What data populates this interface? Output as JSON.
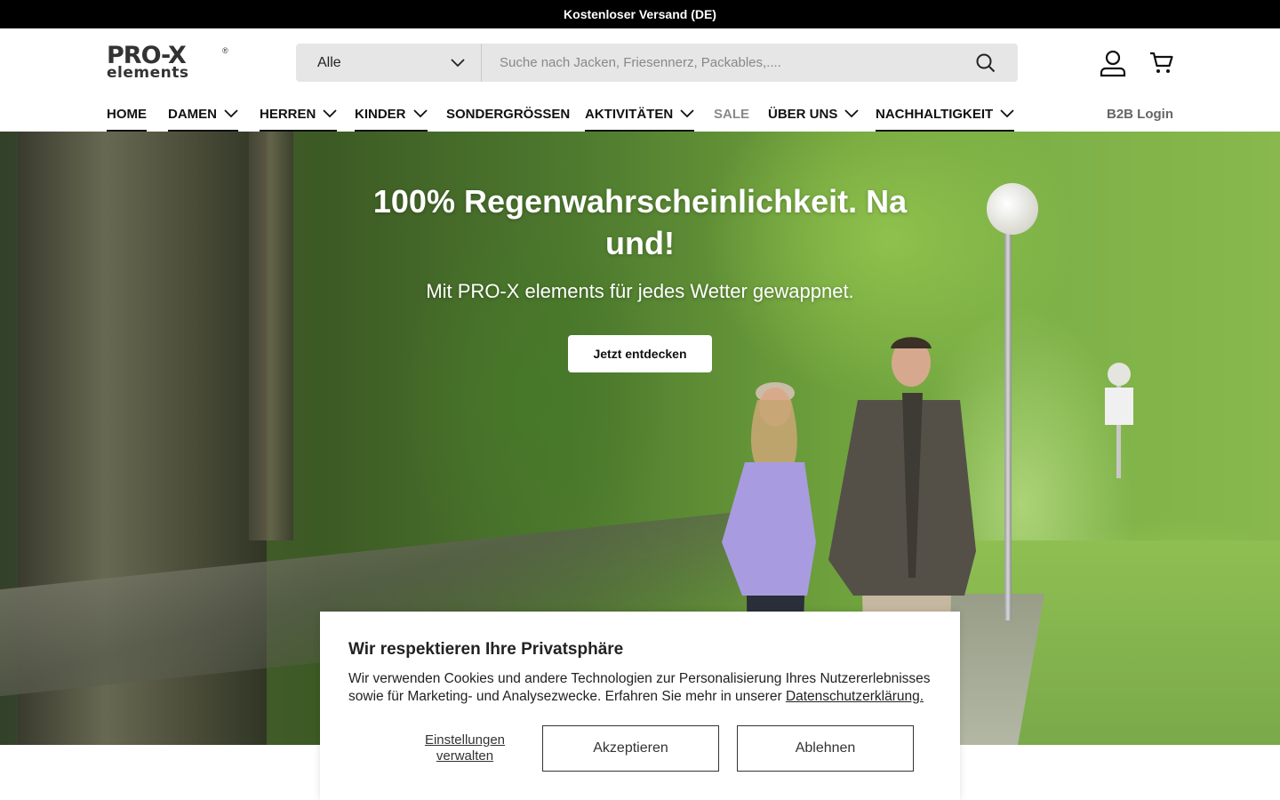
{
  "announcement": {
    "text": "Kostenloser Versand (DE)"
  },
  "logo": {
    "line1": "PRO-X",
    "line2": "elements",
    "reg": "®"
  },
  "search": {
    "category": "Alle",
    "placeholder": "Suche nach Jacken, Friesennerz, Packables,...."
  },
  "header_icons": [
    "search-icon",
    "account-icon",
    "cart-icon"
  ],
  "nav": {
    "items": [
      {
        "label": "HOME"
      },
      {
        "label": "DAMEN"
      },
      {
        "label": "HERREN"
      },
      {
        "label": "KINDER"
      },
      {
        "label": "SONDERGRÖSSEN"
      },
      {
        "label": "AKTIVITÄTEN"
      },
      {
        "label": "SALE"
      },
      {
        "label": "ÜBER UNS"
      },
      {
        "label": "NACHHALTIGKEIT"
      }
    ],
    "b2b": "B2B Login"
  },
  "hero": {
    "title": "100% Regenwahrscheinlichkeit. Na und!",
    "subtitle": "Mit PRO-X elements für jedes Wetter gewappnet.",
    "cta": "Jetzt entdecken"
  },
  "cookie": {
    "title": "Wir respektieren Ihre Privatsphäre",
    "text": "Wir verwenden Cookies und andere Technologien zur Personalisierung Ihres Nutzererlebnisses sowie für Marketing- und Analysezwecke. Erfahren Sie mehr in unserer",
    "link": "Datenschutzerklärung.",
    "manage": "Einstellungen verwalten",
    "accept": "Akzeptieren",
    "decline": "Ablehnen"
  },
  "colors": {
    "announcement_bg": "#000000",
    "search_bg": "#e6e6e6",
    "sale": "#8a8a8a"
  }
}
